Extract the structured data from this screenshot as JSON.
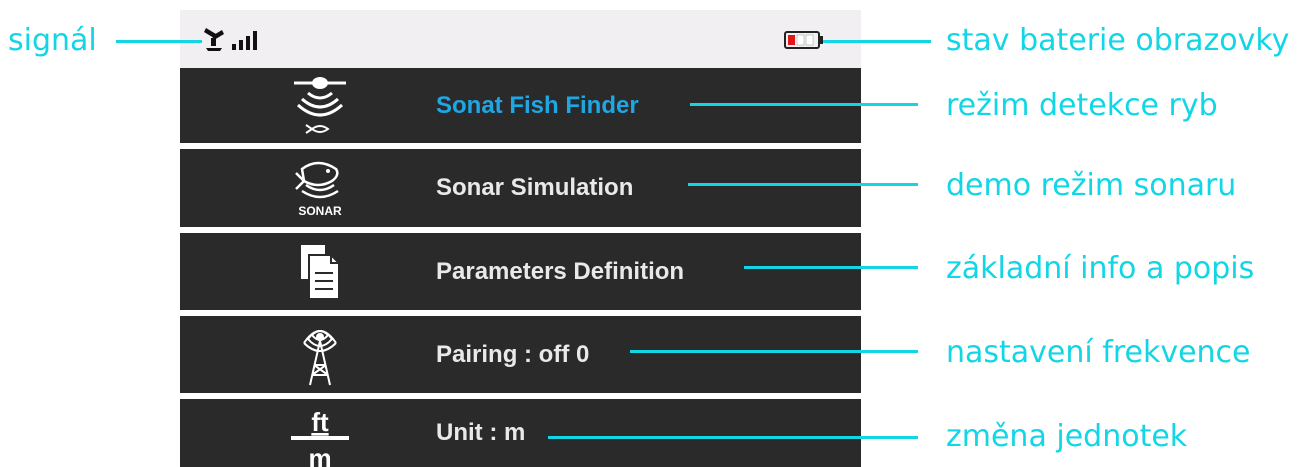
{
  "annotations": {
    "signal": "signál",
    "battery": "stav baterie obrazovky",
    "fish_finder": "režim detekce ryb",
    "sonar_simulation": "demo režim sonaru",
    "parameters": "základní info a popis",
    "pairing": "nastavení frekvence",
    "unit": "změna jednotek"
  },
  "menu": {
    "items": [
      {
        "label": "Sonat Fish Finder",
        "icon": "sonar-fish-finder-icon",
        "active": true
      },
      {
        "label": "Sonar Simulation",
        "icon": "sonar-simulation-icon",
        "active": false
      },
      {
        "label": "Parameters Definition",
        "icon": "document-icon",
        "active": false
      },
      {
        "label": "Pairing : off 0",
        "icon": "antenna-tower-icon",
        "active": false
      },
      {
        "label": "Unit : m",
        "icon": "unit-ft-m-icon",
        "active": false
      }
    ],
    "sonar_icon_text": "SONAR",
    "unit_icon_top": "ft",
    "unit_icon_bottom": "m"
  },
  "colors": {
    "accent_annotation": "#12d6e6",
    "active_label": "#1ea7e4",
    "menu_background": "#2b2a2b",
    "status_bar": "#f1eff2",
    "battery_low": "#e0161b"
  }
}
